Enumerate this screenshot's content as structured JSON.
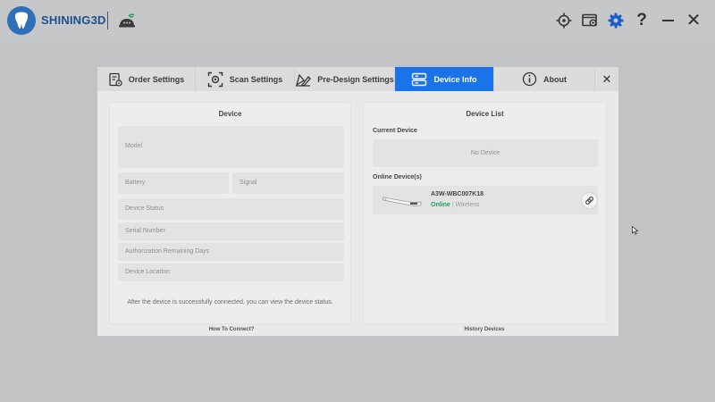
{
  "app": {
    "brand": "SHINING3D"
  },
  "dialog": {
    "tabs": [
      {
        "label": "Order Settings",
        "icon": "order-settings-icon"
      },
      {
        "label": "Scan Settings",
        "icon": "scan-settings-icon"
      },
      {
        "label": "Pre-Design Settings",
        "icon": "pre-design-icon"
      },
      {
        "label": "Device Info",
        "icon": "device-info-icon",
        "active": true
      },
      {
        "label": "About",
        "icon": "info-icon"
      }
    ],
    "close_label": "✕"
  },
  "device_panel": {
    "title": "Device",
    "fields": {
      "model": "Model",
      "battery": "Battery",
      "signal": "Signal",
      "device_status": "Device Status",
      "serial_number": "Serial Number",
      "authorization": "Authorization Remaining Days",
      "location": "Device Location"
    },
    "hint": "After the device is successfully connected, you can view the device status.",
    "footer_link": "How To Connect?"
  },
  "device_list_panel": {
    "title": "Device List",
    "current_label": "Current Device",
    "no_device": "No Device",
    "online_label": "Online Device(s)",
    "online_devices": [
      {
        "name": "A3W-WBC007K18",
        "status": "Online",
        "separator": "|",
        "connection": "Wireless"
      }
    ],
    "footer_link": "History Devices"
  },
  "colors": {
    "accent": "#1a73e8",
    "online": "#1e9e56",
    "brand": "#2d6fb8"
  }
}
